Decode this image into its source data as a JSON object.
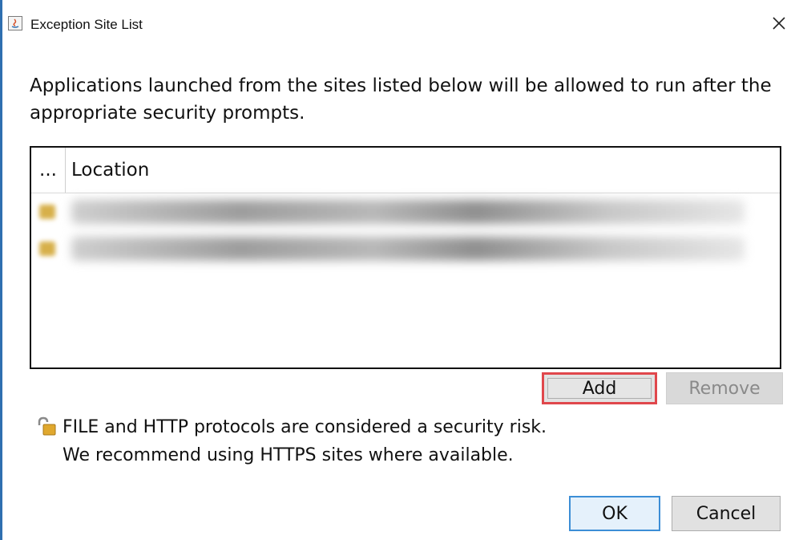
{
  "window": {
    "title": "Exception Site List",
    "icon": "java-icon",
    "close_glyph": "✕"
  },
  "description": "Applications launched from the sites listed below will be allowed to run after the appropriate security prompts.",
  "table": {
    "columns": [
      "...",
      "Location"
    ],
    "rows": [
      {
        "location": ""
      },
      {
        "location": ""
      }
    ]
  },
  "buttons": {
    "add": "Add",
    "remove": "Remove",
    "ok": "OK",
    "cancel": "Cancel"
  },
  "notice": {
    "icon": "unlocked-padlock-icon",
    "line1": "FILE and HTTP protocols are considered a security risk.",
    "line2": "We recommend using HTTPS sites where available."
  },
  "colors": {
    "add_highlight": "#e0474c",
    "ok_border": "#3c8ed6",
    "window_edge": "#2f6fb0"
  }
}
